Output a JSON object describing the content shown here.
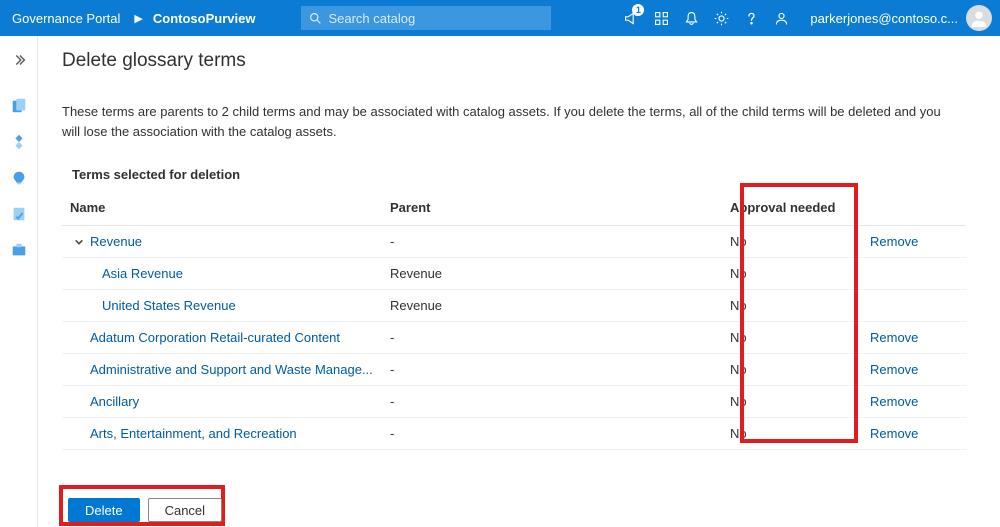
{
  "topbar": {
    "brand": "Governance Portal",
    "account": "ContosoPurview",
    "search_placeholder": "Search catalog",
    "notification_badge": "1",
    "user_email": "parkerjones@contoso.c..."
  },
  "page": {
    "title": "Delete glossary terms",
    "description": "These terms are parents to 2 child terms and may be associated with catalog assets. If you delete the terms, all of the child terms will be deleted and you will lose the association with the catalog assets.",
    "section_title": "Terms selected for deletion"
  },
  "columns": {
    "name": "Name",
    "parent": "Parent",
    "approval": "Approval needed"
  },
  "rows": [
    {
      "name": "Revenue",
      "parent": "-",
      "approval": "No",
      "indent": 0,
      "expandable": true,
      "removable": true
    },
    {
      "name": "Asia Revenue",
      "parent": "Revenue",
      "approval": "No",
      "indent": 1,
      "expandable": false,
      "removable": false
    },
    {
      "name": "United States Revenue",
      "parent": "Revenue",
      "approval": "No",
      "indent": 1,
      "expandable": false,
      "removable": false
    },
    {
      "name": "Adatum Corporation Retail-curated Content",
      "parent": "-",
      "approval": "No",
      "indent": 0,
      "expandable": false,
      "removable": true
    },
    {
      "name": "Administrative and Support and Waste Manage...",
      "parent": "-",
      "approval": "No",
      "indent": 0,
      "expandable": false,
      "removable": true
    },
    {
      "name": "Ancillary",
      "parent": "-",
      "approval": "No",
      "indent": 0,
      "expandable": false,
      "removable": true
    },
    {
      "name": "Arts, Entertainment, and Recreation",
      "parent": "-",
      "approval": "No",
      "indent": 0,
      "expandable": false,
      "removable": true
    }
  ],
  "actions": {
    "remove": "Remove",
    "delete": "Delete",
    "cancel": "Cancel"
  }
}
